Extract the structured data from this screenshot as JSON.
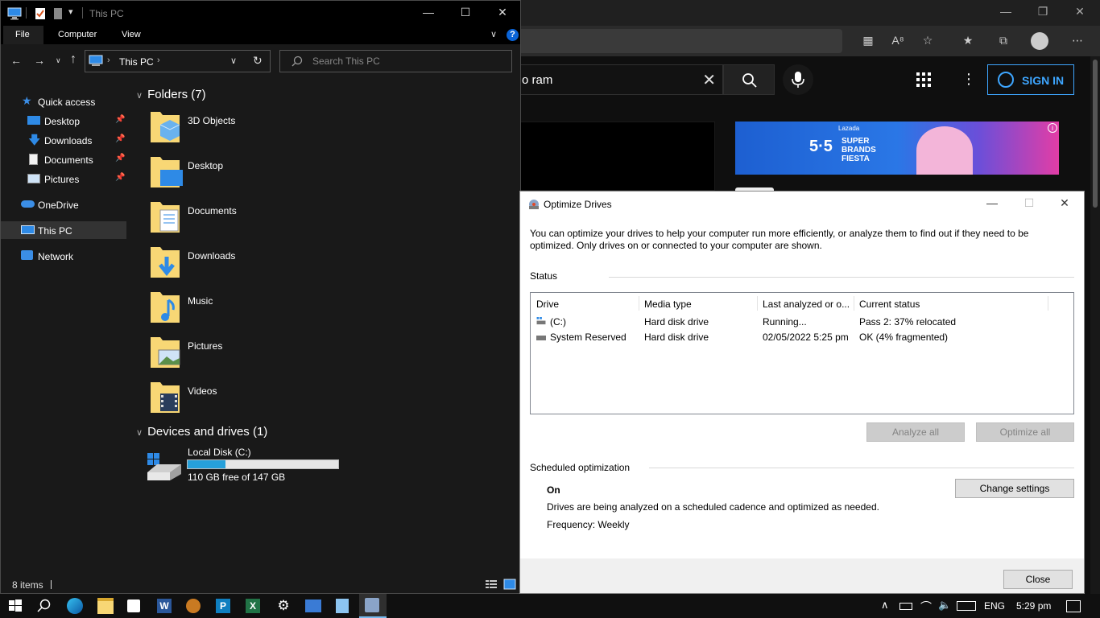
{
  "browser": {
    "search_query": "o ram",
    "sign_in_label": "SIGN IN",
    "ad_headline": "5·5",
    "ad_subtext": "SUPER BRANDS FIESTA",
    "ad_brand": "Lazada"
  },
  "explorer": {
    "window_title": "This PC",
    "ribbon_tabs": [
      "File",
      "Computer",
      "View"
    ],
    "path_label": "This PC",
    "search_placeholder": "Search This PC",
    "nav": {
      "quick_access": "Quick access",
      "desktop": "Desktop",
      "downloads": "Downloads",
      "documents": "Documents",
      "pictures": "Pictures",
      "onedrive": "OneDrive",
      "this_pc": "This PC",
      "network": "Network"
    },
    "folders_header": "Folders (7)",
    "folders": [
      "3D Objects",
      "Desktop",
      "Documents",
      "Downloads",
      "Music",
      "Pictures",
      "Videos"
    ],
    "devices_header": "Devices and drives (1)",
    "drive": {
      "name": "Local Disk (C:)",
      "free_text": "110 GB free of 147 GB",
      "used_fraction": 0.25
    },
    "status_items": "8 items"
  },
  "optimize": {
    "title": "Optimize Drives",
    "description": "You can optimize your drives to help your computer run more efficiently, or analyze them to find out if they need to be optimized. Only drives on or connected to your computer are shown.",
    "status_label": "Status",
    "columns": [
      "Drive",
      "Media type",
      "Last analyzed or o...",
      "Current status"
    ],
    "rows": [
      {
        "drive": "(C:)",
        "media": "Hard disk drive",
        "last": "Running...",
        "status": "Pass 2: 37% relocated"
      },
      {
        "drive": "System Reserved",
        "media": "Hard disk drive",
        "last": "02/05/2022 5:25 pm",
        "status": "OK (4% fragmented)"
      }
    ],
    "analyze_all": "Analyze all",
    "optimize_all": "Optimize all",
    "scheduled_label": "Scheduled optimization",
    "sched_state": "On",
    "change_settings": "Change settings",
    "sched_desc": "Drives are being analyzed on a scheduled cadence and optimized as needed.",
    "frequency": "Frequency: Weekly",
    "close": "Close"
  },
  "taskbar": {
    "language": "ENG",
    "time": "5:29 pm"
  },
  "colors": {
    "accent_blue": "#26a0da",
    "youtube_blue": "#3ea6ff",
    "folder_yellow": "#f8d775"
  }
}
